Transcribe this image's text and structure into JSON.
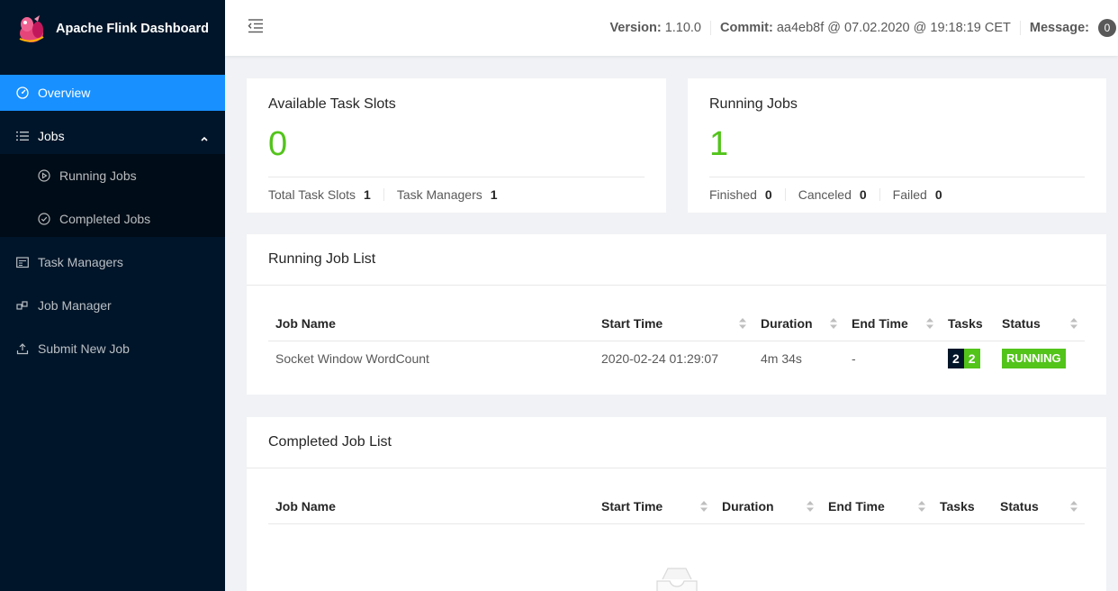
{
  "app": {
    "title": "Apache Flink Dashboard",
    "logo_icon": "squirrel-logo"
  },
  "sidebar": {
    "items": [
      {
        "label": "Overview",
        "icon": "dashboard-icon",
        "active": true
      },
      {
        "label": "Jobs",
        "icon": "list-icon",
        "expanded": true
      },
      {
        "label": "Running Jobs",
        "icon": "play-circle-icon"
      },
      {
        "label": "Completed Jobs",
        "icon": "check-circle-icon"
      },
      {
        "label": "Task Managers",
        "icon": "schedule-icon"
      },
      {
        "label": "Job Manager",
        "icon": "cluster-icon"
      },
      {
        "label": "Submit New Job",
        "icon": "upload-icon"
      }
    ]
  },
  "header": {
    "version_label": "Version:",
    "version": "1.10.0",
    "commit_label": "Commit:",
    "commit": "aa4eb8f @ 07.02.2020 @ 19:18:19 CET",
    "message_label": "Message:",
    "message_count": "0"
  },
  "stats": {
    "slots": {
      "title": "Available Task Slots",
      "value": "0",
      "total_label": "Total Task Slots",
      "total_value": "1",
      "tm_label": "Task Managers",
      "tm_value": "1"
    },
    "jobs": {
      "title": "Running Jobs",
      "value": "1",
      "finished_label": "Finished",
      "finished_value": "0",
      "canceled_label": "Canceled",
      "canceled_value": "0",
      "failed_label": "Failed",
      "failed_value": "0"
    }
  },
  "running_list": {
    "title": "Running Job List",
    "columns": [
      "Job Name",
      "Start Time",
      "Duration",
      "End Time",
      "Tasks",
      "Status"
    ],
    "rows": [
      {
        "name": "Socket Window WordCount",
        "start": "2020-02-24 01:29:07",
        "duration": "4m 34s",
        "end": "-",
        "tasks_total": "2",
        "tasks_running": "2",
        "status": "RUNNING"
      }
    ]
  },
  "completed_list": {
    "title": "Completed Job List",
    "columns": [
      "Job Name",
      "Start Time",
      "Duration",
      "End Time",
      "Tasks",
      "Status"
    ]
  },
  "colors": {
    "sidebar": "#001529",
    "active": "#1890ff",
    "success": "#52c41a"
  }
}
